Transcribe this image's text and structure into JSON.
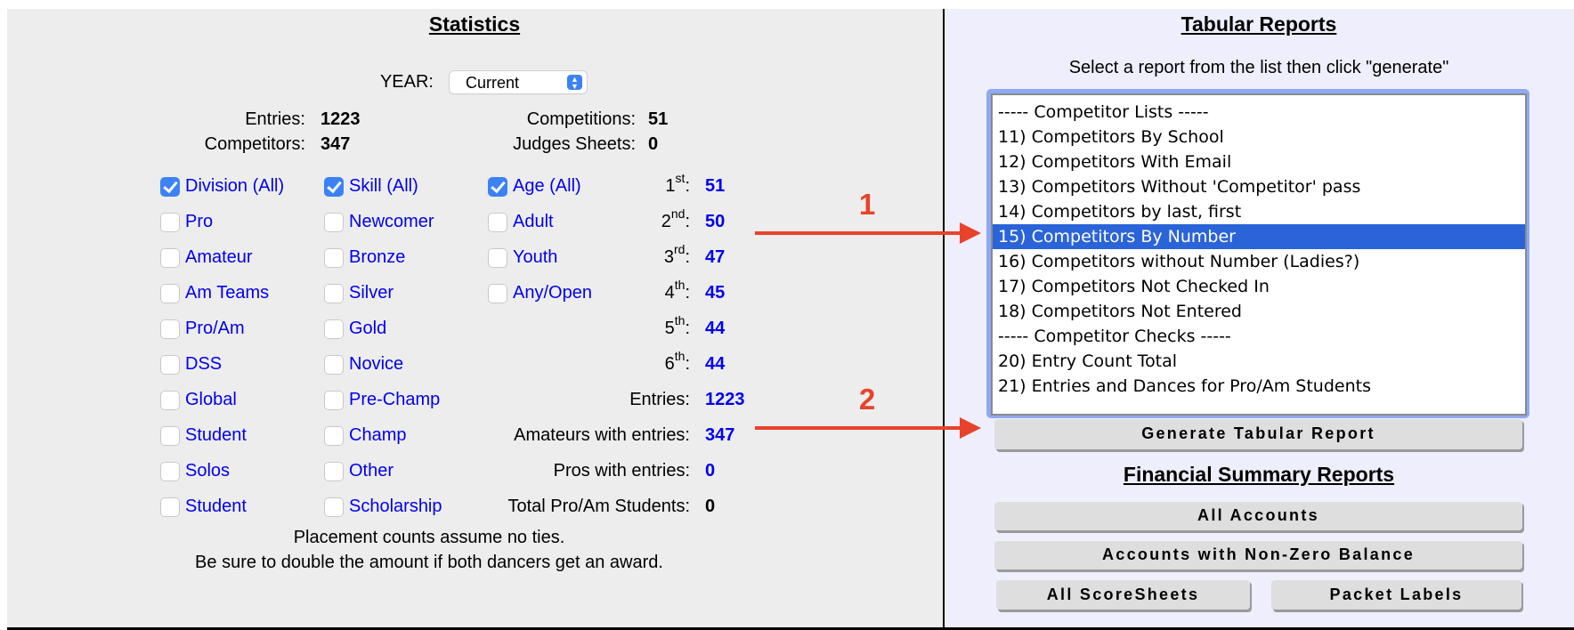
{
  "statistics": {
    "title": "Statistics",
    "year": {
      "label": "YEAR:",
      "selected": "Current"
    },
    "summary": {
      "entries_label": "Entries:",
      "entries_value": "1223",
      "competitors_label": "Competitors:",
      "competitors_value": "347",
      "competitions_label": "Competitions:",
      "competitions_value": "51",
      "judges_label": "Judges Sheets:",
      "judges_value": "0"
    },
    "division": [
      {
        "label": "Division (All)",
        "checked": true
      },
      {
        "label": "Pro",
        "checked": false
      },
      {
        "label": "Amateur",
        "checked": false
      },
      {
        "label": "Am Teams",
        "checked": false
      },
      {
        "label": "Pro/Am",
        "checked": false
      },
      {
        "label": "DSS",
        "checked": false
      },
      {
        "label": "Global",
        "checked": false
      },
      {
        "label": "Student",
        "checked": false
      },
      {
        "label": "Solos",
        "checked": false
      },
      {
        "label": "Student",
        "checked": false
      }
    ],
    "skill": [
      {
        "label": "Skill (All)",
        "checked": true
      },
      {
        "label": "Newcomer",
        "checked": false
      },
      {
        "label": "Bronze",
        "checked": false
      },
      {
        "label": "Silver",
        "checked": false
      },
      {
        "label": "Gold",
        "checked": false
      },
      {
        "label": "Novice",
        "checked": false
      },
      {
        "label": "Pre-Champ",
        "checked": false
      },
      {
        "label": "Champ",
        "checked": false
      },
      {
        "label": "Other",
        "checked": false
      },
      {
        "label": "Scholarship",
        "checked": false
      }
    ],
    "age": [
      {
        "label": "Age (All)",
        "checked": true
      },
      {
        "label": "Adult",
        "checked": false
      },
      {
        "label": "Youth",
        "checked": false
      },
      {
        "label": "Any/Open",
        "checked": false
      }
    ],
    "placements": [
      {
        "num": "1",
        "suffix": "st",
        "value": "51"
      },
      {
        "num": "2",
        "suffix": "nd",
        "value": "50"
      },
      {
        "num": "3",
        "suffix": "rd",
        "value": "47"
      },
      {
        "num": "4",
        "suffix": "th",
        "value": "45"
      },
      {
        "num": "5",
        "suffix": "th",
        "value": "44"
      },
      {
        "num": "6",
        "suffix": "th",
        "value": "44"
      }
    ],
    "totals": [
      {
        "label": "Entries:",
        "value": "1223",
        "color": "#0000ee"
      },
      {
        "label": "Amateurs with entries:",
        "value": "347",
        "color": "#0000ee"
      },
      {
        "label": "Pros with entries:",
        "value": "0",
        "color": "#0000ee"
      },
      {
        "label": "Total Pro/Am Students:",
        "value": "0",
        "color": "#000000"
      }
    ],
    "notes": [
      "Placement counts assume no ties.",
      "Be sure to double the amount if both dancers get an award."
    ]
  },
  "annotations": {
    "arrow1_label": "1",
    "arrow2_label": "2",
    "color": "#e8432a"
  },
  "tabular": {
    "title": "Tabular Reports",
    "instructions": "Select a report from the list then click \"generate\"",
    "options": [
      "----- Competitor Lists -----",
      "11) Competitors By School",
      "12) Competitors With Email",
      "13) Competitors Without 'Competitor' pass",
      "14) Competitors by last, first",
      "15) Competitors By Number",
      "16) Competitors without Number (Ladies?)",
      "17) Competitors Not Checked In",
      "18) Competitors Not Entered",
      "----- Competitor Checks -----",
      "20) Entry Count Total",
      "21) Entries and Dances for Pro/Am Students"
    ],
    "selected_index": 5,
    "generate_label": "Generate Tabular Report"
  },
  "financial": {
    "title": "Financial Summary Reports",
    "all_accounts_label": "All Accounts",
    "nonzero_label": "Accounts with Non-Zero Balance",
    "scoresheets_label": "All ScoreSheets",
    "packet_labels_label": "Packet Labels"
  }
}
